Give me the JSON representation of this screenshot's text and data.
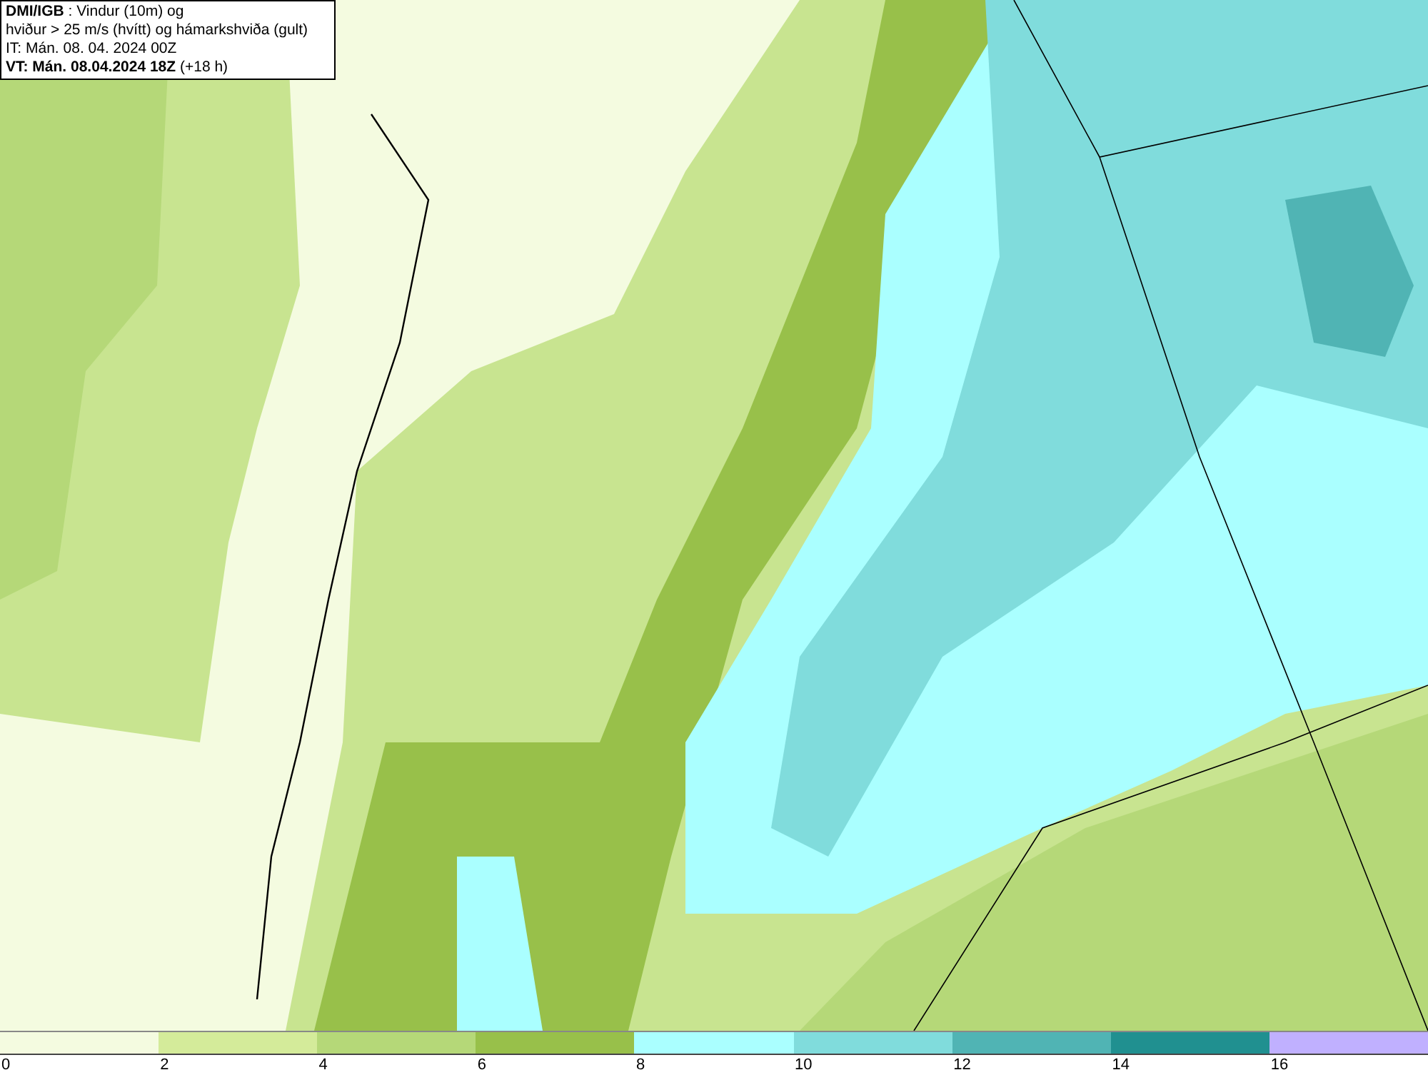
{
  "title_box": {
    "lines": [
      "**DMI/IGB** : Vindur (10m) og",
      "hviður > 25 m/s (hvítt) og hámarkshviða (gult)",
      "IT: Mán. 08. 04. 2024 00Z",
      "**VT: Mán. 08.04.2024 18Z** (+18 h)"
    ]
  },
  "legend": [
    {
      "label": "0",
      "color": "#f4fbe0"
    },
    {
      "label": "2",
      "color": "#d4eb9a"
    },
    {
      "label": "4",
      "color": "#b5d878"
    },
    {
      "label": "6",
      "color": "#98c04a"
    },
    {
      "label": "8",
      "color": "#aaffff"
    },
    {
      "label": "10",
      "color": "#80dcdc"
    },
    {
      "label": "12",
      "color": "#50b4b4"
    },
    {
      "label": "14",
      "color": "#209090"
    },
    {
      "label": "16",
      "color": "#c0b0ff"
    }
  ]
}
